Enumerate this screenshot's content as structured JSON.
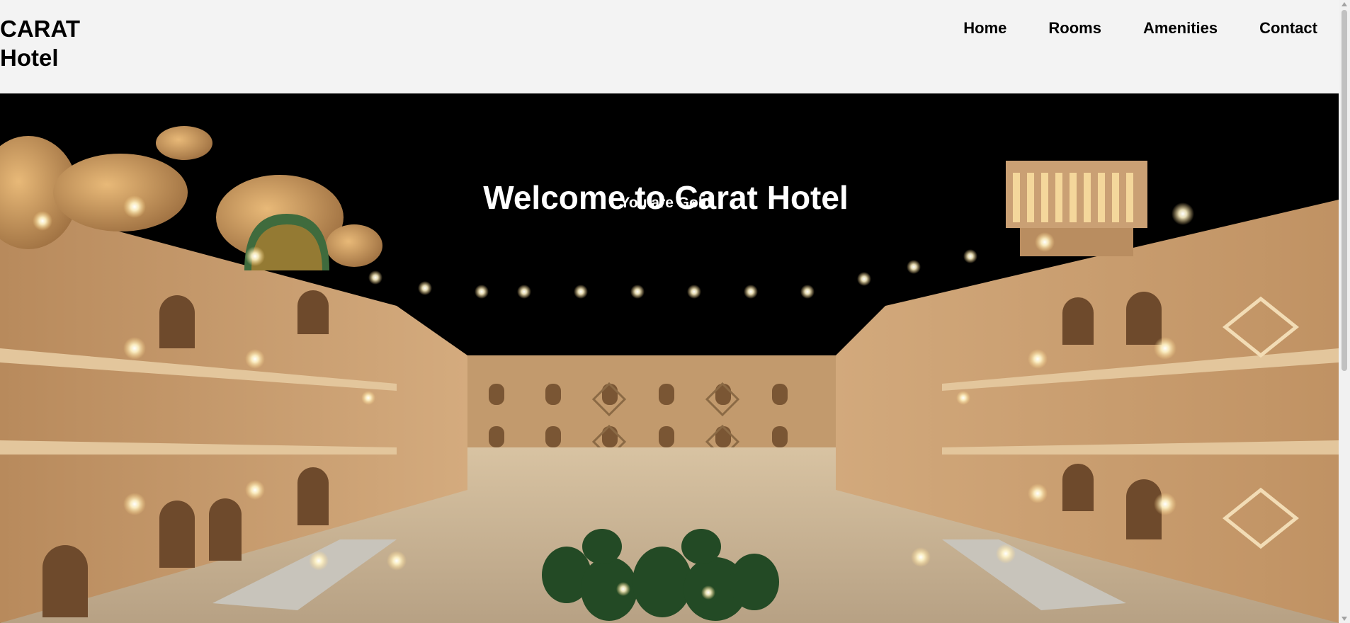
{
  "brand": {
    "line1": "CARAT",
    "line2": "Hotel"
  },
  "nav": {
    "items": [
      "Home",
      "Rooms",
      "Amenities",
      "Contact"
    ]
  },
  "hero": {
    "title": "Welcome to Carat Hotel",
    "subtitle": "You are Gold",
    "image_icon": "hotel-courtyard-night-photo"
  },
  "colors": {
    "header_bg": "#f3f3f3",
    "sky": "#000000",
    "facade": "#c9a072",
    "light": "#fff3c4"
  }
}
